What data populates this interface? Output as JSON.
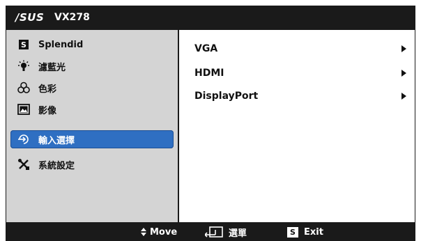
{
  "header": {
    "brand": "/SUS",
    "model": "VX278"
  },
  "sidebar": {
    "items": [
      {
        "label": "Splendid",
        "icon": "splendid-s-icon"
      },
      {
        "label": "濾藍光",
        "icon": "bulb-icon"
      },
      {
        "label": "色彩",
        "icon": "color-icon"
      },
      {
        "label": "影像",
        "icon": "image-icon"
      },
      {
        "label": "輸入選擇",
        "icon": "input-select-icon",
        "selected": true
      },
      {
        "label": "系統設定",
        "icon": "tools-icon"
      }
    ]
  },
  "main": {
    "options": [
      {
        "label": "VGA"
      },
      {
        "label": "HDMI"
      },
      {
        "label": "DisplayPort"
      }
    ]
  },
  "footer": {
    "move": "Move",
    "menu": "選單",
    "exit_key": "S",
    "exit": "Exit"
  },
  "colors": {
    "bar": "#1a1a1a",
    "sidebar": "#d4d4d4",
    "selected": "#2f6fc2"
  }
}
